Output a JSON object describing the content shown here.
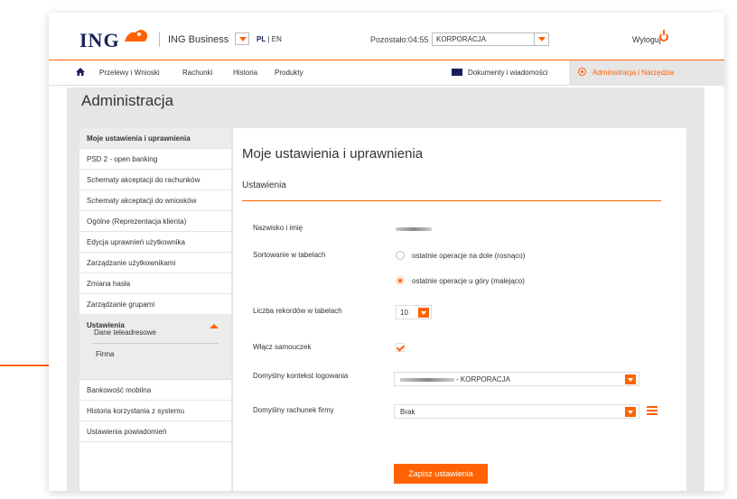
{
  "header": {
    "logo": "ING",
    "business_label": "ING Business",
    "lang_pl": "PL",
    "lang_sep": " | ",
    "lang_en": "EN",
    "session": "Pozostało:04:55",
    "context_value": "KORPORACJA",
    "logout": "Wyloguj"
  },
  "nav": {
    "przelewy": "Przelewy i Wnioski",
    "rachunki": "Rachunki",
    "historia": "Historia",
    "produkty": "Produkty",
    "dokumenty": "Dokumenty i wiadomości",
    "admin": "Administracja i Narzędzia"
  },
  "page_title": "Administracja",
  "sidebar": {
    "items": [
      "Moje ustawienia i uprawnienia",
      "PSD 2 - open banking",
      "Schematy akceptacji do rachunków",
      "Schematy akceptacji do wniosków",
      "Ogólne (Reprezentacja klienta)",
      "Edycja uprawnień użytkownika",
      "Zarządzanie użytkownikami",
      "Zmiana hasła",
      "Zarządzanie grupami",
      "Ustawienia",
      "Bankowość mobilna",
      "Historia korzystania z systemu",
      "Ustawienia powiadomień"
    ],
    "sub_items": [
      "Dane teleadresowe",
      "Firma"
    ]
  },
  "main": {
    "title": "Moje ustawienia i uprawnienia",
    "section": "Ustawienia",
    "labels": {
      "name": "Nazwisko i imię",
      "sort": "Sortowanie w tabelach",
      "records": "Liczba rekordów w tabelach",
      "tutorial": "Włącz samouczek",
      "context": "Domyślny kontekst logowania",
      "account": "Domyślny rachunek firmy"
    },
    "sort_options": [
      "ostatnie operacje na dole (rosnąco)",
      "ostatnie operacje u góry (malejąco)"
    ],
    "records_value": "10",
    "context_value": "- KORPORACJA",
    "account_value": "Brak",
    "save": "Zapisz ustawienia"
  },
  "colors": {
    "accent": "#ff6200",
    "brand": "#16215c",
    "panel_bg": "#e6e6e6"
  }
}
